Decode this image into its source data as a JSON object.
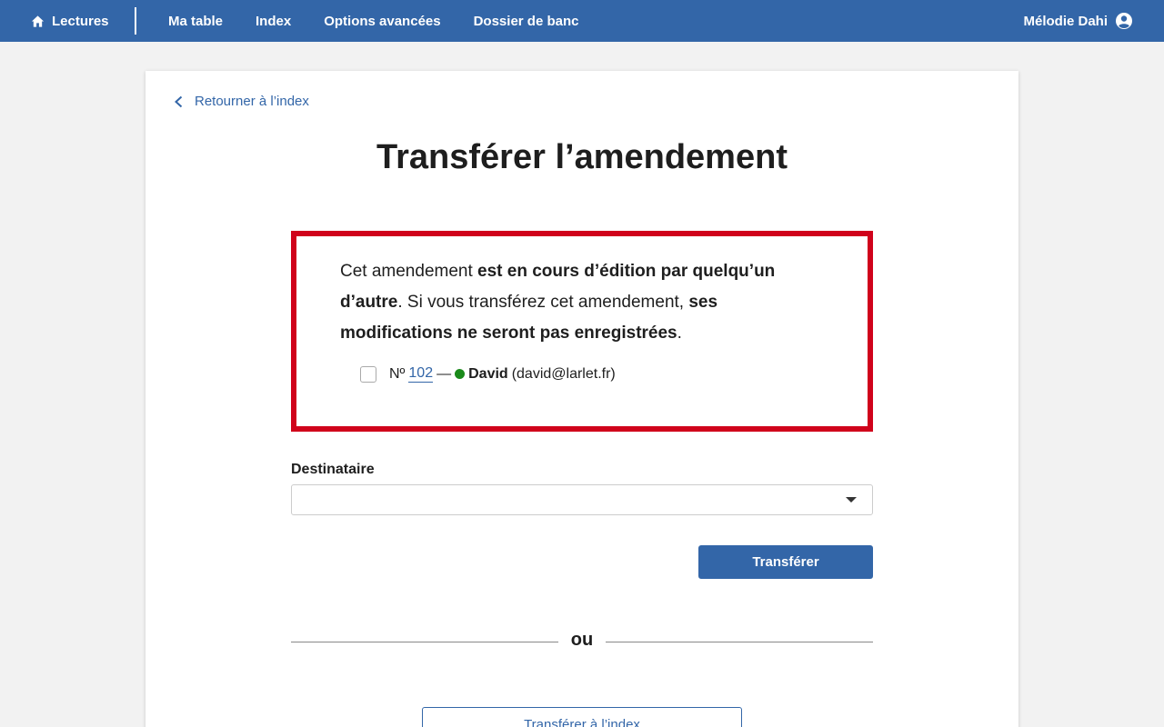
{
  "nav": {
    "home_label": "Lectures",
    "links": [
      "Ma table",
      "Index",
      "Options avancées",
      "Dossier de banc"
    ],
    "user_name": "Mélodie Dahi"
  },
  "page": {
    "back_label": "Retourner à l’index",
    "title": "Transférer l’amendement"
  },
  "warning": {
    "text_1": "Cet amendement ",
    "bold_1": "est en cours d’édition par quelqu’un d’autre",
    "text_2": ". Si vous transférez cet amendement, ",
    "bold_2": "ses modifications ne seront pas enregistrées",
    "text_3": ".",
    "amendment": {
      "num_prefix": "Nº",
      "num": "102",
      "dash": "—",
      "user_name": "David",
      "user_email": "(david@larlet.fr)",
      "checked": false,
      "status_color": "#1a8a1a"
    }
  },
  "form": {
    "destinataire_label": "Destinataire",
    "destinataire_value": "",
    "submit_label": "Transférer"
  },
  "divider_label": "ou",
  "secondary_button_label": "Transférer à l’index",
  "colors": {
    "primary": "#3366a8",
    "warning_border": "#d0021b",
    "background": "#f2f2f2"
  }
}
